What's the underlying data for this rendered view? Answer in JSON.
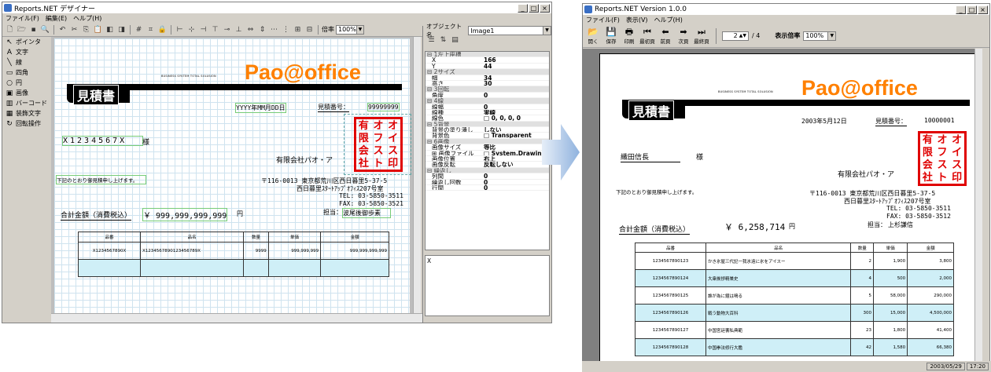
{
  "designer": {
    "title": "Reports.NET デザイナー",
    "menu": [
      "ファイル(F)",
      "編集(E)",
      "ヘルプ(H)"
    ],
    "zoom_label": "倍率",
    "zoom_value": "100%",
    "object_name_label": "オブジェクト名",
    "object_name_value": "Image1",
    "tools": [
      {
        "icon": "pointer-icon",
        "glyph": "↖",
        "label": "ポインタ"
      },
      {
        "icon": "text-icon",
        "glyph": "A",
        "label": "文字"
      },
      {
        "icon": "line-icon",
        "glyph": "╲",
        "label": "線"
      },
      {
        "icon": "rectangle-icon",
        "glyph": "▭",
        "label": "四角"
      },
      {
        "icon": "circle-icon",
        "glyph": "○",
        "label": "円"
      },
      {
        "icon": "image-icon",
        "glyph": "▣",
        "label": "画像"
      },
      {
        "icon": "barcode-icon",
        "glyph": "▥",
        "label": "バーコード"
      },
      {
        "icon": "decor-text-icon",
        "glyph": "▦",
        "label": "装飾文字"
      },
      {
        "icon": "rotate-icon",
        "glyph": "↻",
        "label": "回転操作"
      }
    ],
    "properties": [
      {
        "cat": true,
        "key": "⊟ 1左上座標"
      },
      {
        "key": "X",
        "val": "166"
      },
      {
        "key": "Y",
        "val": "44"
      },
      {
        "cat": true,
        "key": "⊟ 2サイズ"
      },
      {
        "key": "幅",
        "val": "34"
      },
      {
        "key": "高さ",
        "val": "30"
      },
      {
        "cat": true,
        "key": "⊟ 3回転"
      },
      {
        "key": "角度",
        "val": "0"
      },
      {
        "cat": true,
        "key": "⊟ 4線"
      },
      {
        "key": "線幅",
        "val": "0"
      },
      {
        "key": "線種",
        "val": "実線"
      },
      {
        "key": "線色",
        "val": "□ 0, 0, 0, 0"
      },
      {
        "cat": true,
        "key": "⊟ 5背景"
      },
      {
        "key": "背景の塗り潰し",
        "val": "しない"
      },
      {
        "key": "背景色",
        "val": "□ Transparent"
      },
      {
        "cat": true,
        "key": "⊟ 6画像"
      },
      {
        "key": "画像サイズ",
        "val": "等比"
      },
      {
        "key": "⊞ 画像ファイル",
        "val": "□ System.Drawing.Bi"
      },
      {
        "key": "画像位置",
        "val": "右上"
      },
      {
        "key": "画像反転",
        "val": "反転しない"
      },
      {
        "cat": true,
        "key": "⊟ 繰返し"
      },
      {
        "key": "列間",
        "val": "0"
      },
      {
        "key": "繰返し回数",
        "val": "0"
      },
      {
        "key": "行間",
        "val": "0"
      }
    ],
    "prop_desc": "X"
  },
  "report_template": {
    "tagline": "BUSINESS SYSTEM TOTAL SOLUSION",
    "logo": "Pao@office",
    "title": "見積書",
    "date": "YYYY年MM月DD日",
    "estimate_no_label": "見積番号：",
    "estimate_no": "99999999",
    "customer": "X1234567X",
    "honorific": "様",
    "company": "有限会社パオ・ア",
    "greeting": "下記のとおり御見積申し上げます。",
    "address1": "〒116-0013 東京都荒川区西日暮里5-37-5",
    "address2": "西日暮里ｽﾀｰﾄｱｯﾌﾟｵﾌｨｽ207号室",
    "tel": "TEL: 03-5850-3511",
    "fax": "FAX: 03-5850-3521",
    "staff_label": "担当：",
    "staff": "波尾後御歩素",
    "total_label": "合計金額（消費税込）",
    "total": "￥ 999,999,999,999",
    "yen": "円",
    "table_headers": [
      "品番",
      "品名",
      "数量",
      "単価",
      "金額"
    ],
    "table_rows": [
      [
        "X1234567890X",
        "X1234567890123456789X",
        "9999",
        "999,999,999",
        "999,999,999,999"
      ],
      [
        "",
        "",
        "",
        "",
        ""
      ]
    ]
  },
  "seal_chars": [
    "有",
    "オ",
    "オ",
    "限",
    "フ",
    "イ",
    "会",
    "ス",
    "ス",
    "社",
    "ト",
    "印"
  ],
  "preview": {
    "title": "Reports.NET Version 1.0.0",
    "menu": [
      "ファイル(F)",
      "表示(V)",
      "ヘルプ(H)"
    ],
    "buttons": [
      {
        "icon": "open-icon",
        "glyph": "📂",
        "label": "開く"
      },
      {
        "icon": "save-icon",
        "glyph": "💾",
        "label": "保存"
      },
      {
        "icon": "print-icon",
        "glyph": "🖶",
        "label": "印刷"
      },
      {
        "icon": "first-page-icon",
        "glyph": "⏮",
        "label": "最初頁"
      },
      {
        "icon": "prev-page-icon",
        "glyph": "⬅",
        "label": "前頁"
      },
      {
        "icon": "next-page-icon",
        "glyph": "➡",
        "label": "次頁"
      },
      {
        "icon": "last-page-icon",
        "glyph": "⏭",
        "label": "最終頁"
      }
    ],
    "page_current": "2",
    "page_total": "/ 4",
    "zoom_label": "表示倍率",
    "zoom_value": "100%",
    "status_date": "2003/05/29",
    "status_time": "17:20"
  },
  "report_preview": {
    "tagline": "BUSINESS SYSTEM TOTAL SOLUSION",
    "logo": "Pao@office",
    "title": "見積書",
    "date": "2003年5月12日",
    "estimate_no_label": "見積番号：",
    "estimate_no": "10000001",
    "customer": "織田信長",
    "honorific": "様",
    "company": "有限会社パオ・ア",
    "greeting": "下記のとおり御見積申し上げます。",
    "address1": "〒116-0013 東京都荒川区西日暮里5-37-5",
    "address2": "西日暮里ｽﾀｰﾄｱｯﾌﾟｵﾌｨｽ207号室",
    "tel": "TEL: 03-5850-3511",
    "fax": "FAX: 03-5850-3512",
    "staff_label": "担当：",
    "staff": "上杉謙信",
    "total_label": "合計金額（消費税込）",
    "total": "￥ 6,258,714",
    "yen": "円",
    "table_headers": [
      "品番",
      "品名",
      "数量",
      "単価",
      "金額"
    ],
    "table_rows": [
      [
        "1234567890123",
        "かき氷屋三代記一我氷遠に氷をアイスー",
        "2",
        "1,900",
        "3,800"
      ],
      [
        "1234567890124",
        "大衆挨拶精巣史",
        "4",
        "500",
        "2,000"
      ],
      [
        "1234567890125",
        "誰が為に鐘は鳴る",
        "5",
        "58,000",
        "290,000"
      ],
      [
        "1234567890126",
        "戦う動物大百科",
        "300",
        "15,000",
        "4,500,000"
      ],
      [
        "1234567890127",
        "中国宮廷饗私典範",
        "23",
        "1,800",
        "41,400"
      ],
      [
        "1234567890128",
        "中国拳法修行大鑑",
        "42",
        "1,580",
        "66,380"
      ]
    ]
  }
}
